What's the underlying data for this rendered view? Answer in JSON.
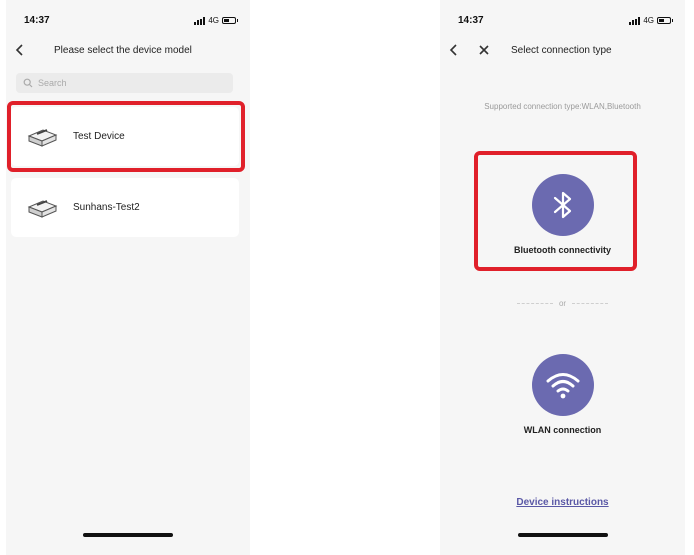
{
  "left_screen": {
    "status": {
      "time": "14:37",
      "network": "4G"
    },
    "nav": {
      "title": "Please select the device model"
    },
    "search": {
      "placeholder": "Search",
      "value": ""
    },
    "devices": [
      {
        "name": "Test Device",
        "icon": "printer-icon",
        "highlighted": true
      },
      {
        "name": "Sunhans-Test2",
        "icon": "printer-icon",
        "highlighted": false
      }
    ]
  },
  "right_screen": {
    "status": {
      "time": "14:37",
      "network": "4G"
    },
    "nav": {
      "title": "Select connection type"
    },
    "supported_text": "Supported connection type:WLAN,Bluetooth",
    "options": [
      {
        "label": "Bluetooth connectivity",
        "icon": "bluetooth-icon",
        "highlighted": true
      },
      {
        "label": "WLAN connection",
        "icon": "wifi-icon",
        "highlighted": false
      }
    ],
    "divider_text": "or",
    "instructions_link": "Device instructions"
  },
  "colors": {
    "accent": "#6b6ab0",
    "highlight": "#e0202a",
    "link": "#5a58a6",
    "background": "#f6f6f6"
  }
}
